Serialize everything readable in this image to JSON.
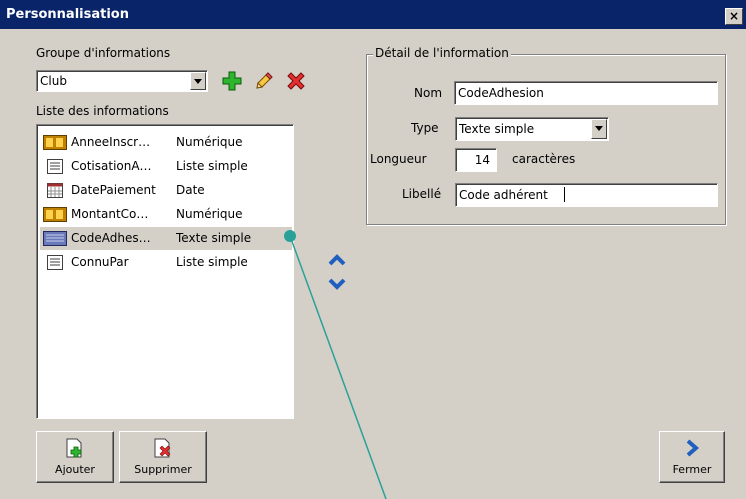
{
  "window": {
    "title": "Personnalisation",
    "close_glyph": "×"
  },
  "group": {
    "label": "Groupe d'informations",
    "selected": "Club",
    "add_icon": "plus-icon",
    "edit_icon": "pencil-icon",
    "delete_icon": "x-icon"
  },
  "list": {
    "label": "Liste des informations",
    "items": [
      {
        "name": "AnneeInscr…",
        "type": "Numérique",
        "icon": "numeric-icon"
      },
      {
        "name": "CotisationA…",
        "type": "Liste simple",
        "icon": "list-icon"
      },
      {
        "name": "DatePaiement",
        "type": "Date",
        "icon": "calendar-icon"
      },
      {
        "name": "MontantCo…",
        "type": "Numérique",
        "icon": "numeric-icon"
      },
      {
        "name": "CodeAdhes…",
        "type": "Texte simple",
        "icon": "text-icon",
        "selected": true
      },
      {
        "name": "ConnuPar",
        "type": "Liste simple",
        "icon": "list-icon"
      }
    ]
  },
  "detail": {
    "legend": "Détail de l'information",
    "nom_label": "Nom",
    "nom_value": "CodeAdhesion",
    "type_label": "Type",
    "type_value": "Texte simple",
    "longueur_label": "Longueur",
    "longueur_value": "14",
    "longueur_unit": "caractères",
    "libelle_label": "Libellé",
    "libelle_value": "Code adhérent"
  },
  "buttons": {
    "ajouter": "Ajouter",
    "supprimer": "Supprimer",
    "fermer": "Fermer"
  },
  "colors": {
    "titlebar": "#0a246a",
    "face": "#d4d0c8",
    "pointer": "#2aa198"
  }
}
